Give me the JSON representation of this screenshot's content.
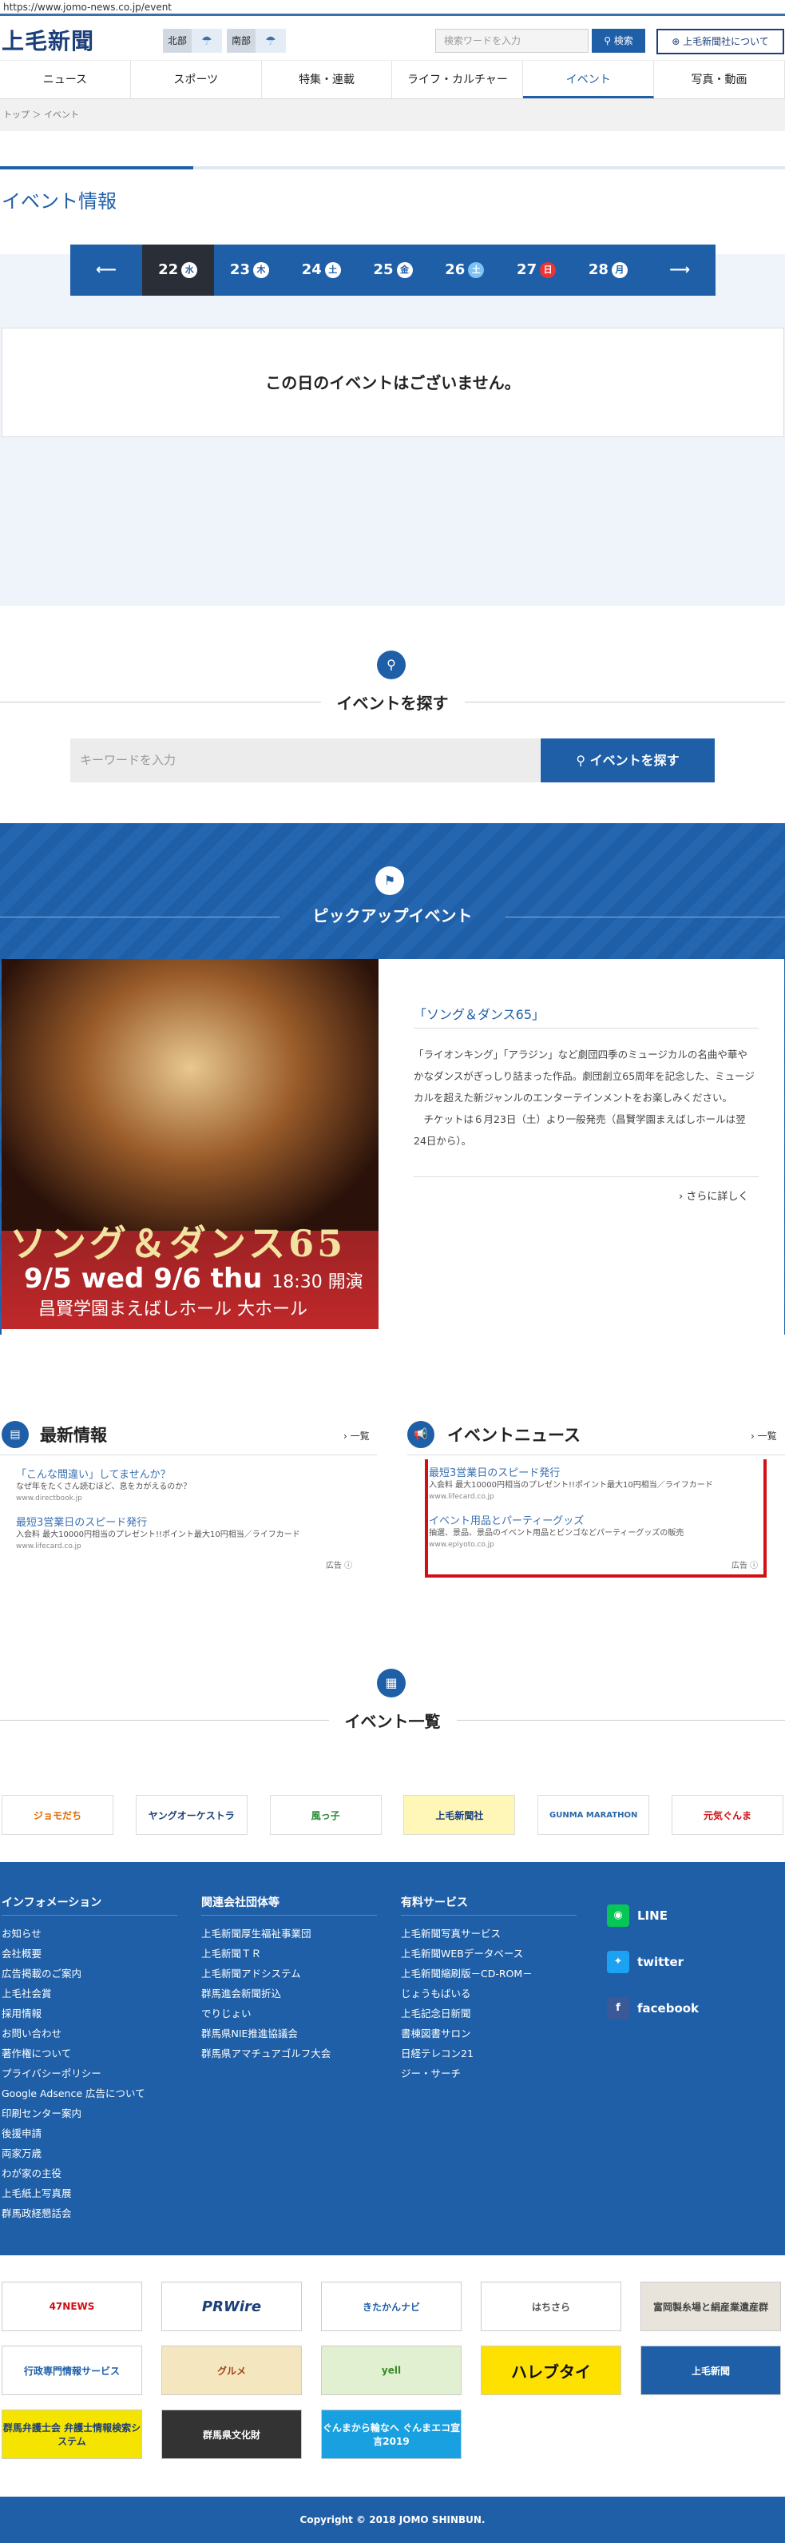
{
  "url": "https://www.jomo-news.co.jp/event",
  "header": {
    "logo": "上毛新聞",
    "weather": [
      {
        "label": "北部"
      },
      {
        "label": "南部"
      }
    ],
    "search_placeholder": "検索ワードを入力",
    "search_button": "検索",
    "about_button": "上毛新聞社について"
  },
  "nav": [
    "ニュース",
    "スポーツ",
    "特集・連載",
    "ライフ・カルチャー",
    "イベント",
    "写真・動画"
  ],
  "breadcrumb": "トップ ＞ イベント",
  "page_title": "イベント情報",
  "dates": [
    {
      "day": "22",
      "wd": "水"
    },
    {
      "day": "23",
      "wd": "木"
    },
    {
      "day": "24",
      "wd": "土"
    },
    {
      "day": "25",
      "wd": "金"
    },
    {
      "day": "26",
      "wd": "土"
    },
    {
      "day": "27",
      "wd": "日"
    },
    {
      "day": "28",
      "wd": "月"
    }
  ],
  "no_events": "この日のイベントはございません。",
  "search_section": {
    "title": "イベントを探す",
    "placeholder": "キーワードを入力",
    "button": "イベントを探す"
  },
  "pickup": {
    "title": "ピックアップイベント",
    "image_title": "ソング＆ダンス65",
    "image_dates": "9/5 wed  9/6 thu",
    "image_time": "18:30 開演",
    "image_hall": "昌賢学園まえばしホール 大ホール",
    "event_title": "「ソング＆ダンス65」",
    "desc1": "「ライオンキング」「アラジン」など劇団四季のミュージカルの名曲や華やかなダンスがぎっしり詰まった作品。劇団創立65周年を記念した、ミュージカルを超えた新ジャンルのエンターテインメントをお楽しみください。",
    "desc2": "チケットは６月23日（土）より一般発売（昌賢学園まえばしホールは翌24日から）。",
    "more": "さらに詳しく"
  },
  "latest": {
    "title": "最新情報",
    "list": "一覧",
    "ads": [
      {
        "t": "「こんな間違い」してませんか？",
        "d": "なぜ年をたくさん読むほど、息をカがえるのか？",
        "u": "www.directbook.jp"
      },
      {
        "t": "最短3営業日のスピード発行",
        "d": "入会料 最大10000円相当のプレゼント!!ポイント最大10円相当／ライフカード",
        "u": "www.lifecard.co.jp"
      }
    ],
    "ad_label": "広告"
  },
  "event_news": {
    "title": "イベントニュース",
    "list": "一覧",
    "ads": [
      {
        "t": "最短3営業日のスピード発行",
        "d": "入会料 最大10000円相当のプレゼント!!ポイント最大10円相当／ライフカード",
        "u": "www.lifecard.co.jp"
      },
      {
        "t": "イベント用品とパーティーグッズ",
        "d": "抽選、景品、景品のイベント用品とビンゴなどパーティーグッズの販売",
        "u": "www.epiyoto.co.jp"
      }
    ],
    "ad_label": "広告"
  },
  "event_list_title": "イベント一覧",
  "partner_logos": [
    "ジョモだち",
    "ヤングオーケストラ",
    "風っ子",
    "上毛新聞社",
    "GUNMA MARATHON",
    "元気ぐんま"
  ],
  "footer": {
    "info": {
      "title": "インフォメーション",
      "items": [
        "お知らせ",
        "会社概要",
        "広告掲載のご案内",
        "上毛社会賞",
        "採用情報",
        "お問い合わせ",
        "著作権について",
        "プライバシーポリシー",
        "Google Adsence 広告について",
        "印刷センター案内",
        "後援申請",
        "両家万歳",
        "わが家の主役",
        "上毛紙上写真展",
        "群馬政経懇話会"
      ]
    },
    "related": {
      "title": "関連会社団体等",
      "items": [
        "上毛新聞厚生福祉事業団",
        "上毛新聞ＴＲ",
        "上毛新聞アドシステム",
        "群馬進会新聞折込",
        "でりじょい",
        "群馬県NIE推進協議会",
        "群馬県アマチュアゴルフ大会"
      ]
    },
    "paid": {
      "title": "有料サービス",
      "items": [
        "上毛新聞写真サービス",
        "上毛新聞WEBデータベース",
        "上毛新聞縮刷版－CD-ROM－",
        "じょうもばいる",
        "上毛記念日新聞",
        "書棟図書サロン",
        "日経テレコン21",
        "ジー・サーチ"
      ]
    },
    "social": [
      "LINE",
      "twitter",
      "facebook"
    ]
  },
  "banners": [
    "47NEWS",
    "PRWire",
    "きたかんナビ",
    "はちさら",
    "富岡製糸場と絹産業遺産群",
    "行政専門情報サービス",
    "グルメ",
    "yell",
    "ハレブタイ",
    "上毛新聞",
    "群馬弁護士会 弁護士情報検索システム",
    "群馬県文化財",
    "ぐんまから輪なへ ぐんまエコ宣言2019"
  ],
  "copyright": "Copyright © 2018 JOMO SHINBUN."
}
